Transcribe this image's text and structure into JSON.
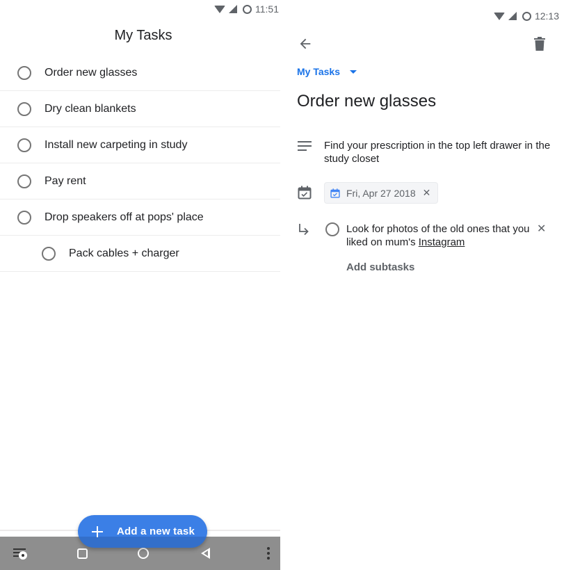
{
  "left_screen": {
    "status_bar": {
      "time": "11:51",
      "icons": [
        "wifi-icon",
        "signal-icon",
        "battery-icon"
      ]
    },
    "title": "My Tasks",
    "tasks": [
      {
        "label": "Order new glasses",
        "completed": false,
        "subtask": false
      },
      {
        "label": "Dry clean blankets",
        "completed": false,
        "subtask": false
      },
      {
        "label": "Install new carpeting in study",
        "completed": false,
        "subtask": false
      },
      {
        "label": "Pay rent",
        "completed": false,
        "subtask": false
      },
      {
        "label": "Drop speakers off at pops' place",
        "completed": false,
        "subtask": false
      },
      {
        "label": "Pack cables + charger",
        "completed": false,
        "subtask": true
      }
    ],
    "fab": {
      "label": "Add a new task",
      "icon": "plus-icon",
      "color": "#3b7fe6"
    },
    "nav_bar": {
      "buttons": [
        "menu-icon",
        "recents-icon",
        "home-icon",
        "back-icon",
        "more-icon"
      ]
    }
  },
  "right_screen": {
    "status_bar": {
      "time": "12:13",
      "icons": [
        "wifi-icon",
        "signal-icon",
        "battery-icon"
      ]
    },
    "toolbar": {
      "back_icon": "arrow-left-icon",
      "delete_icon": "trash-icon"
    },
    "list_selector": {
      "value": "My Tasks",
      "accent": "#1a73e8"
    },
    "task_title": "Order new glasses",
    "notes": "Find your prescription in the top left drawer in the study closet",
    "due_date": {
      "label": "Fri, Apr 27 2018",
      "clear_icon": "close-icon"
    },
    "subtasks": [
      {
        "text_before": "Look for photos of the old ones that you liked on mum's ",
        "link_text": "Instagram",
        "completed": false
      }
    ],
    "add_subtasks_label": "Add subtasks"
  }
}
